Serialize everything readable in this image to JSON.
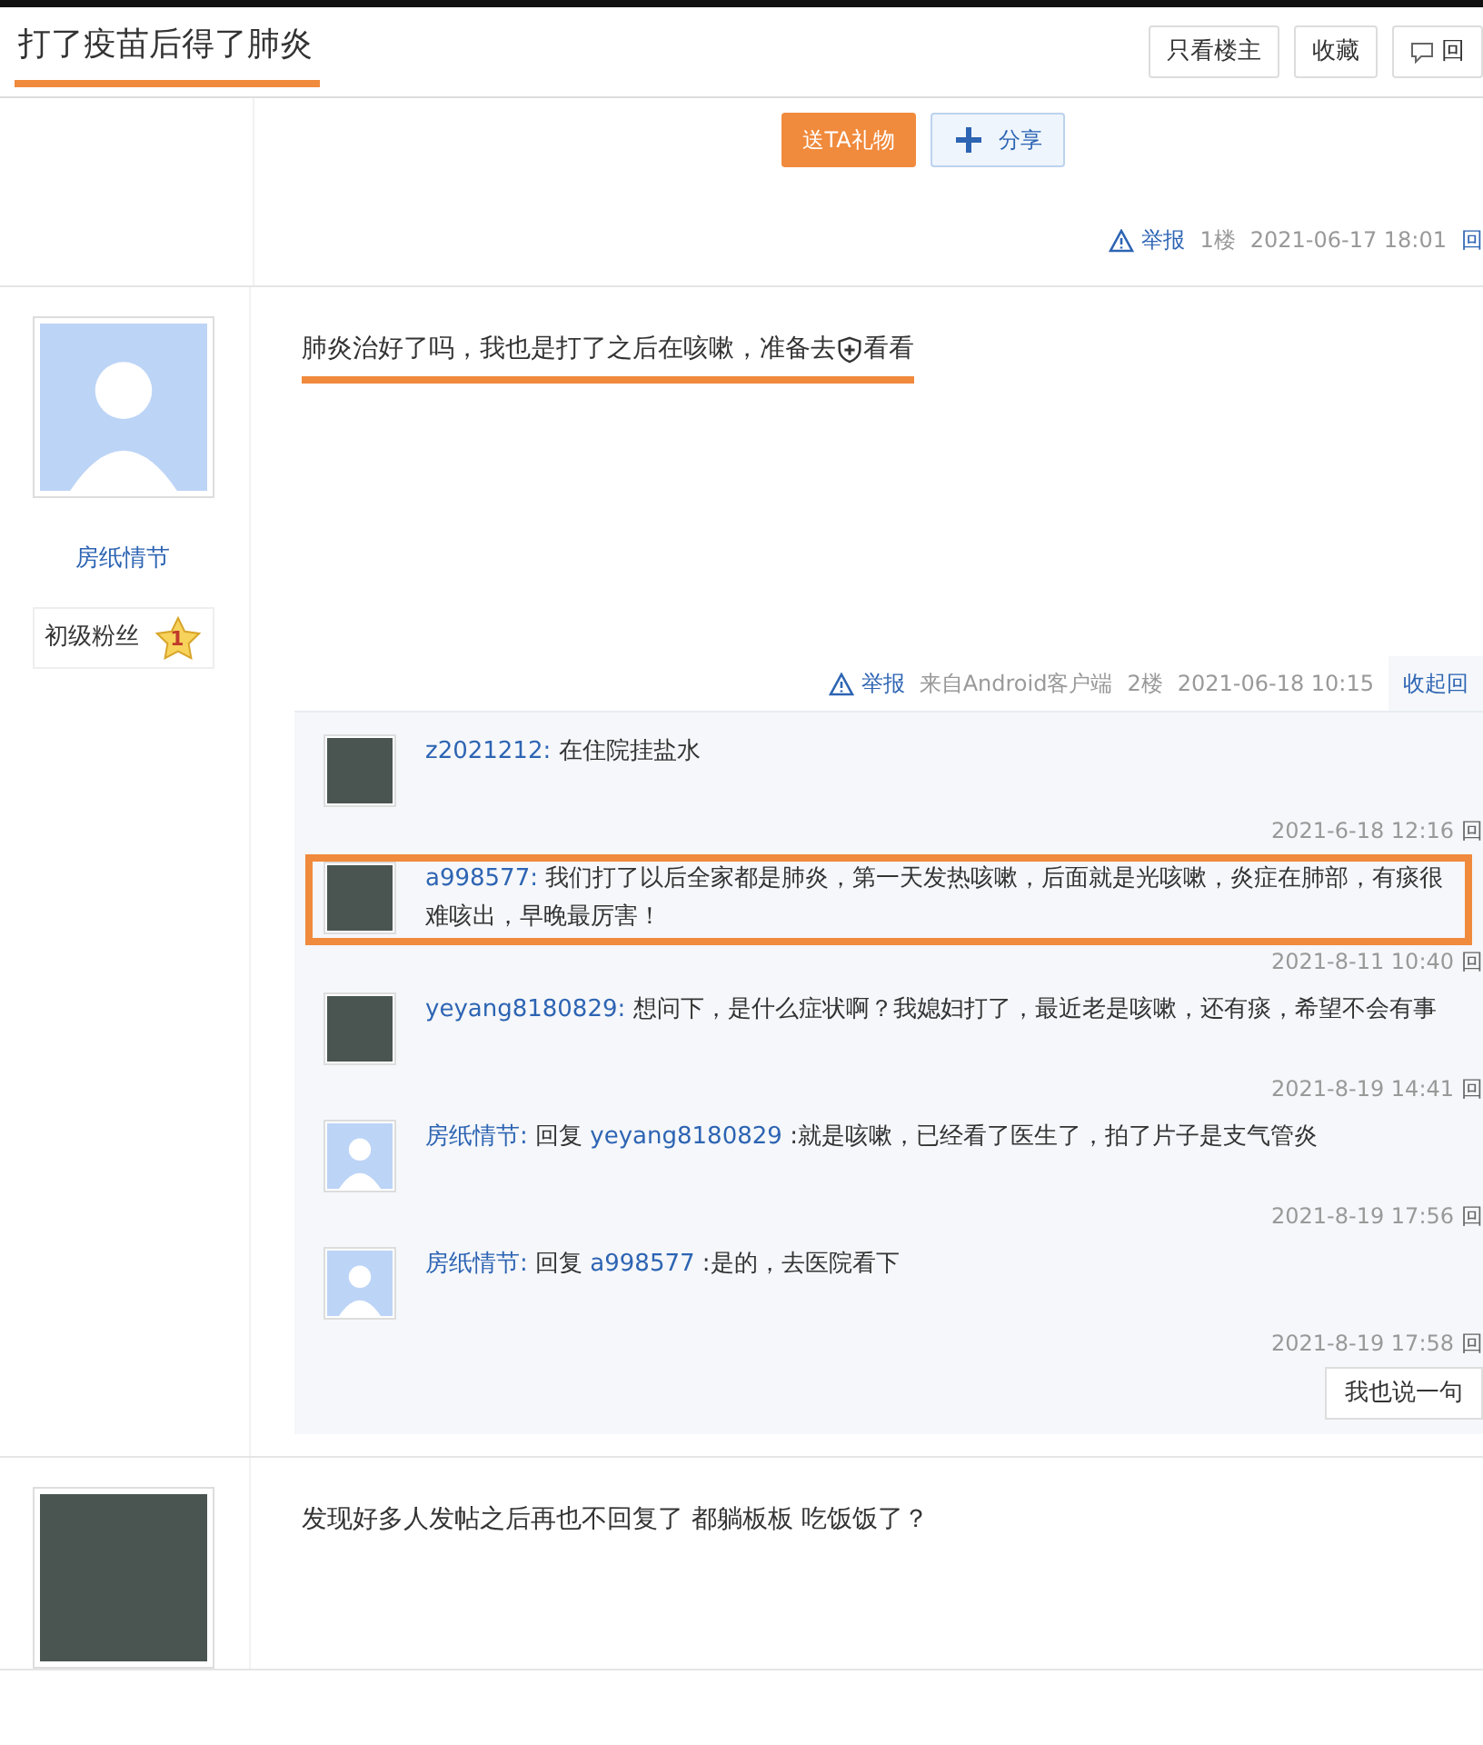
{
  "thread": {
    "title": "打了疫苗后得了肺炎",
    "highlighted": true
  },
  "header_buttons": [
    {
      "label": "只看楼主",
      "kind": "plain"
    },
    {
      "label": "收藏",
      "kind": "plain"
    },
    {
      "label": "回",
      "kind": "reply"
    }
  ],
  "floors": [
    {
      "kind": "first",
      "gift_button": "送TA礼物",
      "share_button": "分享",
      "report": "举报",
      "floor": "1楼",
      "time": "2021-06-17 18:01",
      "tail": "回"
    },
    {
      "kind": "post",
      "user": {
        "name": "房纸情节",
        "rank": "初级粉丝",
        "level": "1",
        "avatar": {
          "kind": "default"
        }
      },
      "text_before": "肺炎治好了吗，我也是打了之后在咳嗽，准备去",
      "text_after": "看看",
      "highlighted": true,
      "report": "举报",
      "source": "来自Android客户端",
      "floor": "2楼",
      "time": "2021-06-18 10:15",
      "collapse": "收起回",
      "comments": [
        {
          "user": "z2021212:",
          "avatar": {
            "kind": "photo"
          },
          "text": "在住院挂盐水",
          "time": "2021-6-18 12:16",
          "reply": "回",
          "highlighted": false
        },
        {
          "user": "a998577:",
          "avatar": {
            "kind": "photo"
          },
          "text": "我们打了以后全家都是肺炎，第一天发热咳嗽，后面就是光咳嗽，炎症在肺部，有痰很难咳出，早晚最厉害！",
          "time": "2021-8-11 10:40",
          "reply": "回",
          "highlighted": true
        },
        {
          "user": "yeyang8180829:",
          "avatar": {
            "kind": "photo"
          },
          "text": "想问下，是什么症状啊？我媳妇打了，最近老是咳嗽，还有痰，希望不会有事",
          "time": "2021-8-19 14:41",
          "reply": "回",
          "highlighted": false
        },
        {
          "user": "房纸情节:",
          "avatar": {
            "kind": "default"
          },
          "reply_prefix": "回复",
          "reply_to": "yeyang8180829",
          "text": ":就是咳嗽，已经看了医生了，拍了片子是支气管炎",
          "time": "2021-8-19 17:56",
          "reply": "回",
          "highlighted": false
        },
        {
          "user": "房纸情节:",
          "avatar": {
            "kind": "default"
          },
          "reply_prefix": "回复",
          "reply_to": "a998577",
          "text": ":是的，去医院看下",
          "time": "2021-8-19 17:58",
          "reply": "回",
          "highlighted": false
        }
      ],
      "say_button": "我也说一句"
    },
    {
      "kind": "post",
      "user": {
        "avatar": {
          "kind": "photo"
        }
      },
      "text_before": "发现好多人发帖之后再也不回复了 都躺板板 吃饭饭了？",
      "highlighted": false
    }
  ]
}
